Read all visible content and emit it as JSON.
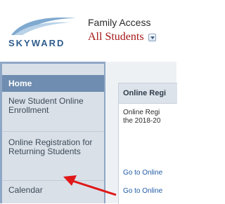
{
  "header": {
    "logo_text": "SKYWARD",
    "app_title": "Family Access",
    "student_selector": "All Students"
  },
  "sidebar": {
    "items": [
      {
        "label": "Home"
      },
      {
        "label": "New Student Online Enrollment"
      },
      {
        "label": "Online Registration for Returning Students"
      },
      {
        "label": "Calendar"
      }
    ]
  },
  "main": {
    "panel_title": "Online Regi",
    "body_lines": [
      "Online Regi",
      "the 2018-20"
    ],
    "links": [
      "Go to Online",
      "Go to Online"
    ]
  },
  "colors": {
    "accent": "#6f8db0",
    "student_select": "#a31515",
    "annotation_arrow": "#e01818"
  }
}
